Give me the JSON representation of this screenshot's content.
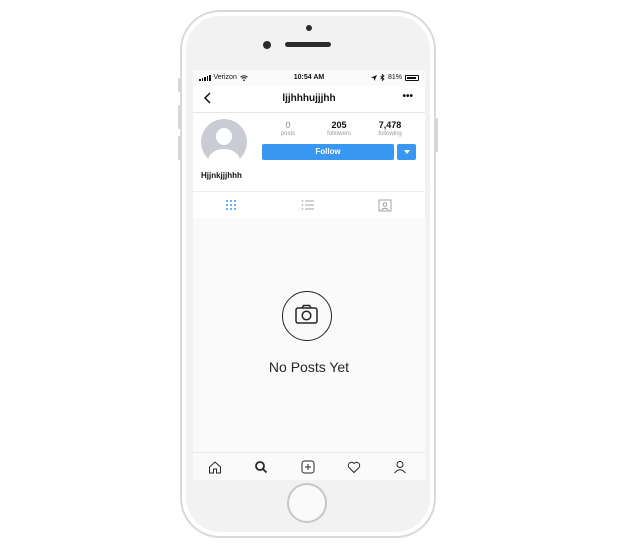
{
  "status_bar": {
    "carrier": "Verizon",
    "time": "10:54 AM",
    "battery": "81%"
  },
  "nav": {
    "title": "ljjhhhujjjhh",
    "more": "•••"
  },
  "profile": {
    "name": "Hjjnkjjjhhh",
    "stats": [
      {
        "value": "0",
        "label": "posts"
      },
      {
        "value": "205",
        "label": "followers"
      },
      {
        "value": "7,478",
        "label": "following"
      }
    ],
    "follow_label": "Follow"
  },
  "tabs": [
    "grid-icon",
    "list-icon",
    "tagged-icon"
  ],
  "empty_state": {
    "text": "No Posts Yet",
    "icon": "camera-icon"
  },
  "bottom_nav": [
    "home-icon",
    "search-icon",
    "add-post-icon",
    "activity-heart-icon",
    "profile-icon"
  ],
  "colors": {
    "accent": "#3897f0",
    "active_tab": "#3897f0",
    "text": "#262626"
  }
}
